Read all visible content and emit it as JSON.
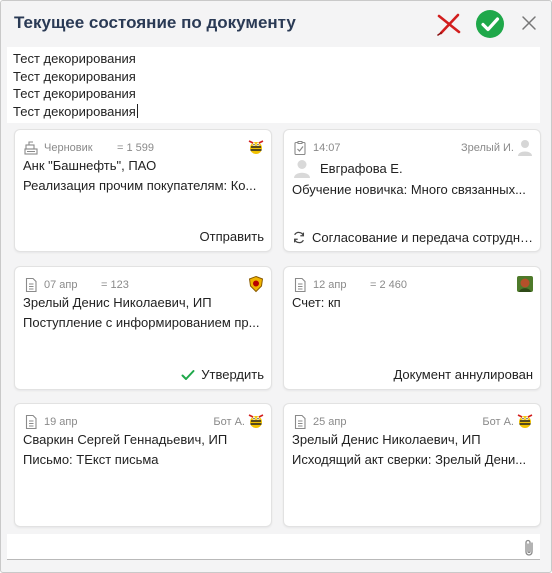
{
  "dialog": {
    "title": "Текущее состояние по документу",
    "colors": {
      "title": "#2a3a55",
      "reject": "#d21e1e",
      "accept": "#1fa84a",
      "muted": "#8a8a8a"
    }
  },
  "header": {
    "reject_icon": "red-cross-icon",
    "accept_icon": "green-check-circle-icon",
    "close_icon": "close-x-icon"
  },
  "comment": {
    "lines": [
      "Тест декорирования",
      "Тест декорирования",
      "Тест декорирования",
      "Тест декорирования"
    ]
  },
  "cards": [
    {
      "doc_icon": "cash-register-icon",
      "date": "Черновик",
      "sum": "= 1 599",
      "avatar": "bee-mascot-avatar",
      "line1": "Анк \"Башнефть\", ПАО",
      "line2": "Реализация прочим покупателям: Ко...",
      "action": "Отправить"
    },
    {
      "doc_icon": "task-checklist-icon",
      "date": "14:07",
      "right": "Зрелый И.",
      "avatar": "placeholder-person-avatar",
      "person": "Евграфова Е.",
      "line2": "Обучение новичка: Много связанных...",
      "task_icon": "sync-icon",
      "task": "Согласование и передача сотрудника..."
    },
    {
      "doc_icon": "document-icon",
      "date": "07 апр",
      "sum": "= 123",
      "avatar": "shield-badge-avatar",
      "line1": "Зрелый Денис Николаевич, ИП",
      "line2": "Поступление с информированием пр...",
      "action_icon": "checkmark-icon",
      "action": "Утвердить"
    },
    {
      "doc_icon": "document-icon",
      "date": "12 апр",
      "sum": "= 2 460",
      "avatar": "photo-avatar",
      "line1": "Счет: кп",
      "status": "Документ аннулирован"
    },
    {
      "doc_icon": "document-icon",
      "date": "19 апр",
      "right": "Бот А.",
      "avatar": "bee-mascot-avatar",
      "line1": "Сваркин Сергей Геннадьевич, ИП",
      "line2": "Письмо: ТЕкст письма"
    },
    {
      "doc_icon": "document-icon",
      "date": "25 апр",
      "right": "Бот А.",
      "avatar": "bee-mascot-avatar",
      "line1": "Зрелый Денис Николаевич, ИП",
      "line2": "Исходящий акт сверки: Зрелый Дени..."
    }
  ],
  "footer": {
    "attach_icon": "paperclip-icon"
  }
}
